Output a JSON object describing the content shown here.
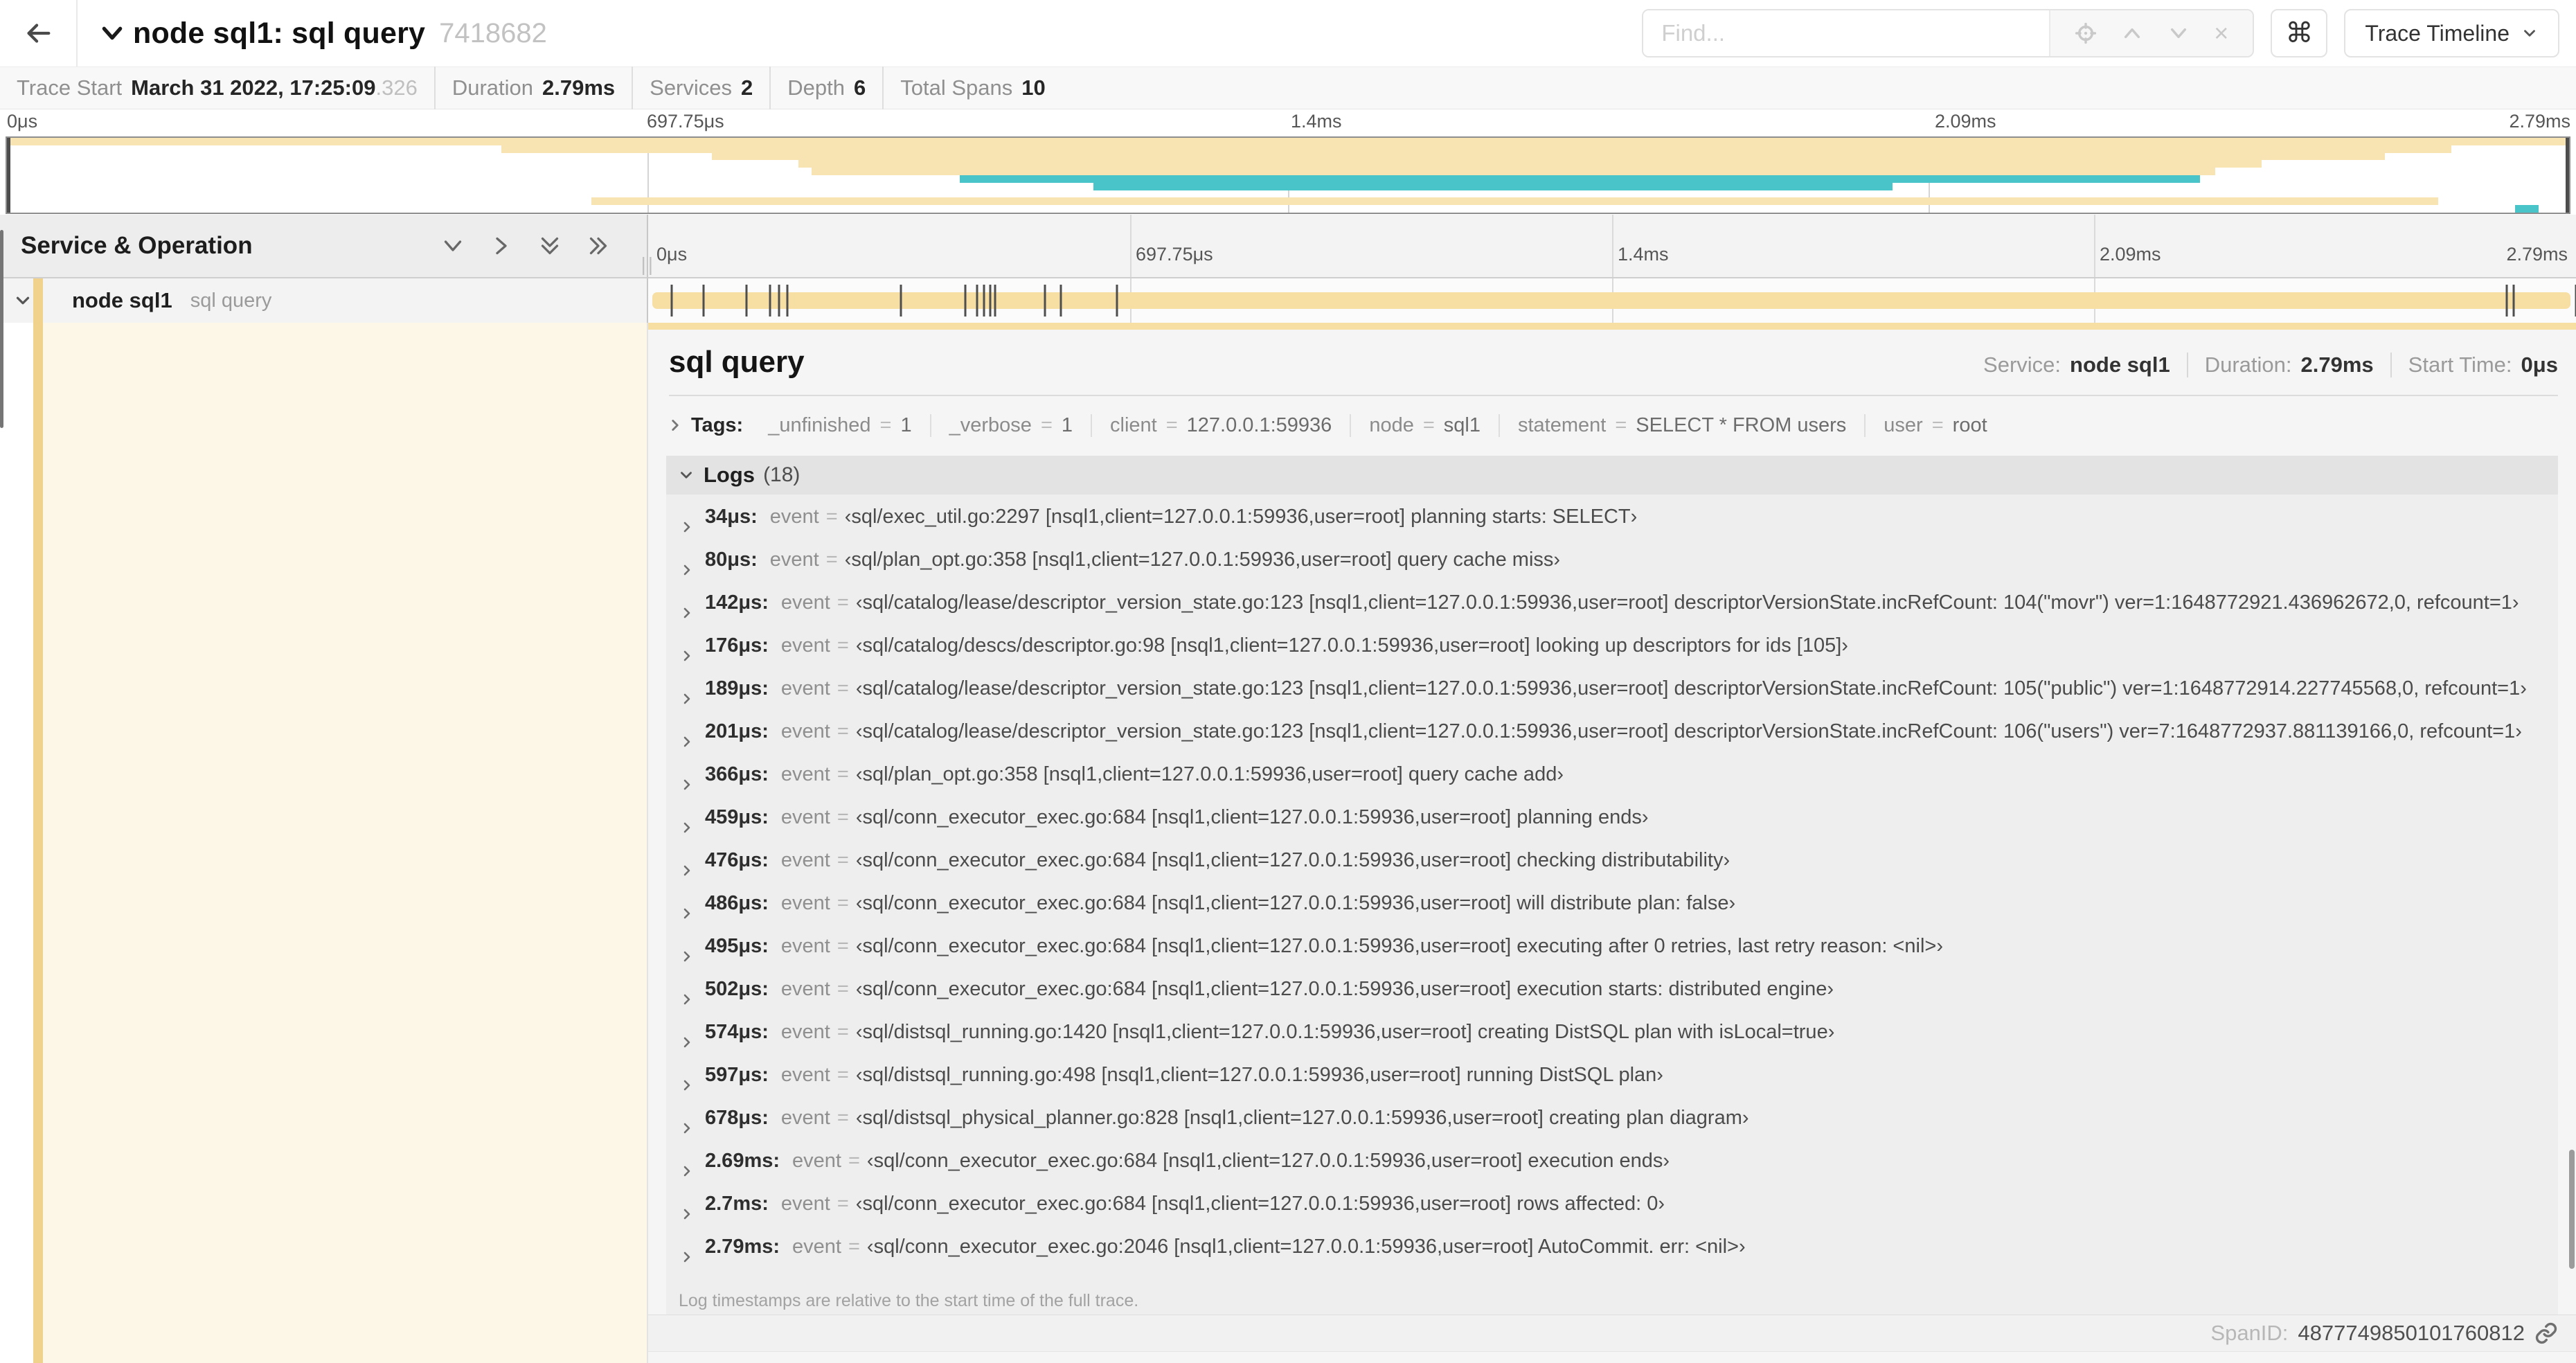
{
  "colors": {
    "tan": "#f8e3b2",
    "teal": "#49c4c8",
    "bar_tan": "#f7dfa4",
    "stripe": "#f0d28c",
    "cream": "#fdf7e8"
  },
  "header": {
    "title": "node sql1: sql query",
    "trace_id": "7418682",
    "find_placeholder": "Find...",
    "shortcut_key": "⌘",
    "view_selector_label": "Trace Timeline"
  },
  "trace_info": {
    "items": [
      {
        "label": "Trace Start",
        "value": "March 31 2022, 17:25:09",
        "suffix": ".326"
      },
      {
        "label": "Duration",
        "value": "2.79ms"
      },
      {
        "label": "Services",
        "value": "2"
      },
      {
        "label": "Depth",
        "value": "6"
      },
      {
        "label": "Total Spans",
        "value": "10"
      }
    ]
  },
  "timeline": {
    "ticks": [
      "0μs",
      "697.75μs",
      "1.4ms",
      "2.09ms",
      "2.79ms"
    ],
    "duration_us": 2790
  },
  "minimap": {
    "bars": [
      {
        "row": 1,
        "start": 0,
        "end": 100,
        "color": "tan"
      },
      {
        "row": 2,
        "start": 19.3,
        "end": 95.4,
        "color": "tan"
      },
      {
        "row": 3,
        "start": 27.5,
        "end": 92.8,
        "color": "tan"
      },
      {
        "row": 4,
        "start": 30.9,
        "end": 88.0,
        "color": "tan"
      },
      {
        "row": 5,
        "start": 31.4,
        "end": 86.2,
        "color": "tan"
      },
      {
        "row": 6,
        "start": 37.2,
        "end": 85.6,
        "color": "teal"
      },
      {
        "row": 7,
        "start": 42.4,
        "end": 73.6,
        "color": "teal"
      },
      {
        "row": 9,
        "start": 22.8,
        "end": 94.9,
        "color": "tan"
      },
      {
        "row": 10,
        "start": 97.9,
        "end": 98.8,
        "color": "teal"
      }
    ]
  },
  "left_panel": {
    "header": "Service & Operation",
    "resizer_grip": "||"
  },
  "span_row": {
    "service": "node sql1",
    "operation": "sql query",
    "log_marker_times_us": [
      34,
      80,
      142,
      176,
      189,
      201,
      366,
      459,
      476,
      486,
      495,
      502,
      574,
      597,
      678,
      2690,
      2700,
      2790
    ]
  },
  "detail": {
    "title": "sql query",
    "meta": [
      {
        "label": "Service:",
        "value": "node sql1"
      },
      {
        "label": "Duration:",
        "value": "2.79ms"
      },
      {
        "label": "Start Time:",
        "value": "0μs"
      }
    ],
    "tags_label": "Tags:",
    "kv_separator": "=",
    "tags": [
      {
        "key": "_unfinished",
        "value": "1"
      },
      {
        "key": "_verbose",
        "value": "1"
      },
      {
        "key": "client",
        "value": "127.0.0.1:59936"
      },
      {
        "key": "node",
        "value": "sql1"
      },
      {
        "key": "statement",
        "value": "SELECT * FROM users"
      },
      {
        "key": "user",
        "value": "root"
      }
    ],
    "logs_label": "Logs",
    "logs_count": "(18)",
    "log_key": "event",
    "logs": [
      {
        "time": "34μs:",
        "text": "‹sql/exec_util.go:2297 [nsql1,client=127.0.0.1:59936,user=root] planning starts: SELECT›"
      },
      {
        "time": "80μs:",
        "text": "‹sql/plan_opt.go:358 [nsql1,client=127.0.0.1:59936,user=root] query cache miss›"
      },
      {
        "time": "142μs:",
        "text": "‹sql/catalog/lease/descriptor_version_state.go:123 [nsql1,client=127.0.0.1:59936,user=root] descriptorVersionState.incRefCount: 104(\"movr\") ver=1:1648772921.436962672,0, refcount=1›"
      },
      {
        "time": "176μs:",
        "text": "‹sql/catalog/descs/descriptor.go:98 [nsql1,client=127.0.0.1:59936,user=root] looking up descriptors for ids [105]›"
      },
      {
        "time": "189μs:",
        "text": "‹sql/catalog/lease/descriptor_version_state.go:123 [nsql1,client=127.0.0.1:59936,user=root] descriptorVersionState.incRefCount: 105(\"public\") ver=1:1648772914.227745568,0, refcount=1›"
      },
      {
        "time": "201μs:",
        "text": "‹sql/catalog/lease/descriptor_version_state.go:123 [nsql1,client=127.0.0.1:59936,user=root] descriptorVersionState.incRefCount: 106(\"users\") ver=7:1648772937.881139166,0, refcount=1›"
      },
      {
        "time": "366μs:",
        "text": "‹sql/plan_opt.go:358 [nsql1,client=127.0.0.1:59936,user=root] query cache add›"
      },
      {
        "time": "459μs:",
        "text": "‹sql/conn_executor_exec.go:684 [nsql1,client=127.0.0.1:59936,user=root] planning ends›"
      },
      {
        "time": "476μs:",
        "text": "‹sql/conn_executor_exec.go:684 [nsql1,client=127.0.0.1:59936,user=root] checking distributability›"
      },
      {
        "time": "486μs:",
        "text": "‹sql/conn_executor_exec.go:684 [nsql1,client=127.0.0.1:59936,user=root] will distribute plan: false›"
      },
      {
        "time": "495μs:",
        "text": "‹sql/conn_executor_exec.go:684 [nsql1,client=127.0.0.1:59936,user=root] executing after 0 retries, last retry reason: <nil>›"
      },
      {
        "time": "502μs:",
        "text": "‹sql/conn_executor_exec.go:684 [nsql1,client=127.0.0.1:59936,user=root] execution starts: distributed engine›"
      },
      {
        "time": "574μs:",
        "text": "‹sql/distsql_running.go:1420 [nsql1,client=127.0.0.1:59936,user=root] creating DistSQL plan with isLocal=true›"
      },
      {
        "time": "597μs:",
        "text": "‹sql/distsql_running.go:498 [nsql1,client=127.0.0.1:59936,user=root] running DistSQL plan›"
      },
      {
        "time": "678μs:",
        "text": "‹sql/distsql_physical_planner.go:828 [nsql1,client=127.0.0.1:59936,user=root] creating plan diagram›"
      },
      {
        "time": "2.69ms:",
        "text": "‹sql/conn_executor_exec.go:684 [nsql1,client=127.0.0.1:59936,user=root] execution ends›"
      },
      {
        "time": "2.7ms:",
        "text": "‹sql/conn_executor_exec.go:684 [nsql1,client=127.0.0.1:59936,user=root] rows affected: 0›"
      },
      {
        "time": "2.79ms:",
        "text": "‹sql/conn_executor_exec.go:2046 [nsql1,client=127.0.0.1:59936,user=root] AutoCommit. err: <nil>›"
      }
    ],
    "footer_note": "Log timestamps are relative to the start time of the full trace.",
    "span_id_label": "SpanID:",
    "span_id": "4877749850101760812"
  }
}
